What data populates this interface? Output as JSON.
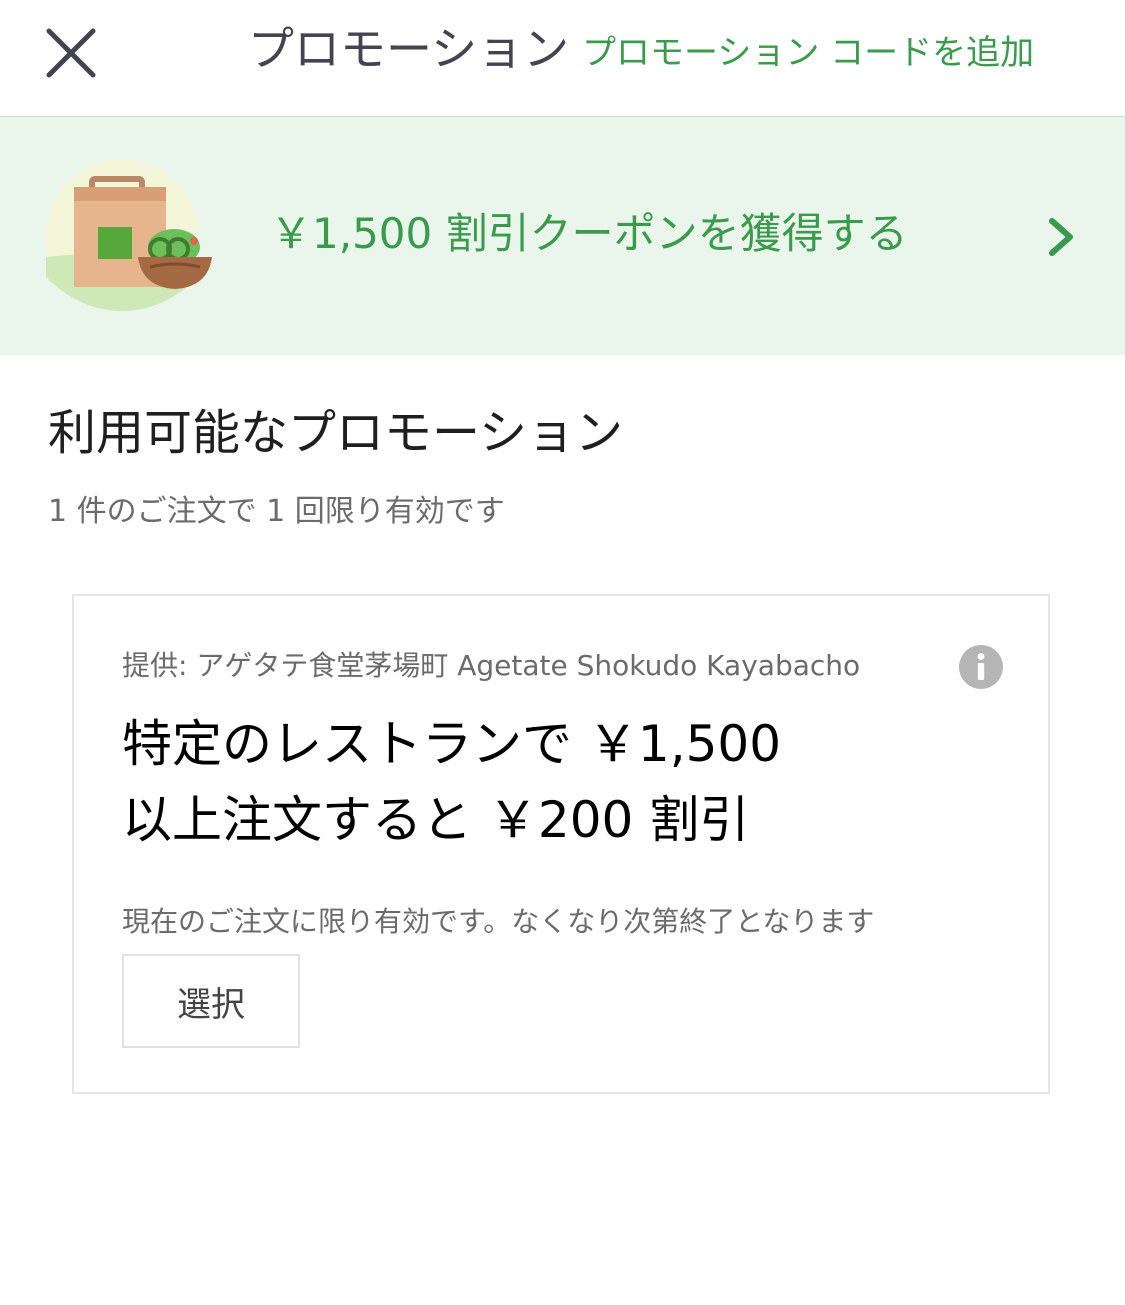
{
  "header": {
    "close_icon": "close-icon",
    "title": "プロモーション",
    "add_code_label": "プロモーション コードを追加"
  },
  "banner": {
    "illustration": "grocery-bag-salad-illustration",
    "text": "￥1,500 割引クーポンを獲得する",
    "chevron_icon": "chevron-right-icon"
  },
  "section": {
    "title": "利用可能なプロモーション",
    "subtitle": "1 件のご注文で 1 回限り有効です"
  },
  "promo": {
    "provider": "提供: アゲタテ食堂茅場町 Agetate Shokudo Kayabacho",
    "info_icon": "info-icon",
    "headline_line1": "特定のレストランで ￥1,500",
    "headline_line2": "以上注文すると ￥200 割引",
    "note": "現在のご注文に限り有効です。なくなり次第終了となります",
    "select_label": "選択"
  },
  "colors": {
    "accent_green": "#3a9b4c",
    "banner_bg": "#eaf6ec",
    "header_text": "#444451",
    "muted_text": "#6b6b6b"
  }
}
